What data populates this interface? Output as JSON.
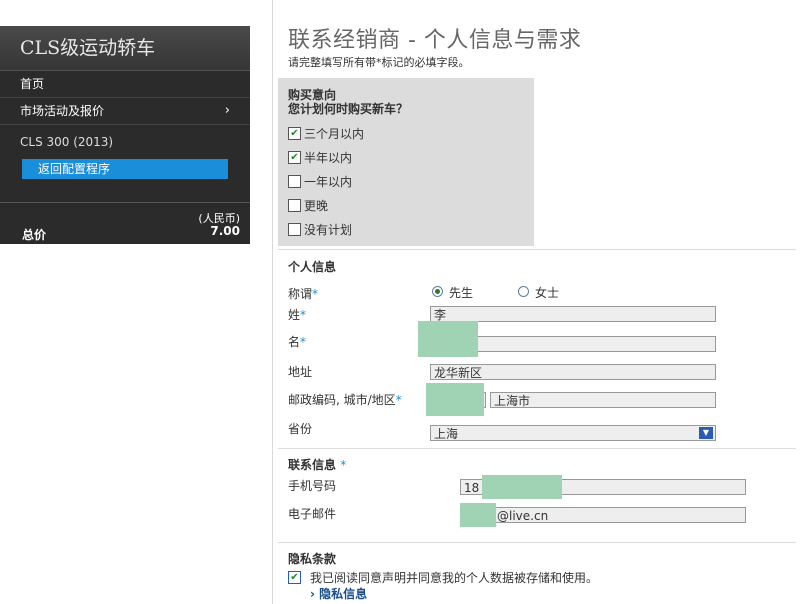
{
  "sidebar": {
    "title": "CLS级运动轿车",
    "items": [
      {
        "label": "首页",
        "chevron": ""
      },
      {
        "label": "市场活动及报价",
        "chevron": "›"
      }
    ],
    "model": "CLS 300 (2013)",
    "back_button": "返回配置程序",
    "total_label": "总价",
    "currency": "(人民币)",
    "price": "7.00"
  },
  "main": {
    "title": "联系经销商 - 个人信息与需求",
    "subtitle": "请完整填写所有带*标记的必填字段。"
  },
  "purchase": {
    "heading1": "购买意向",
    "heading2": "您计划何时购买新车？",
    "options": [
      {
        "label": "三个月以内",
        "checked": true
      },
      {
        "label": "半年以内",
        "checked": true
      },
      {
        "label": "一年以内",
        "checked": false
      },
      {
        "label": "更晚",
        "checked": false
      },
      {
        "label": "没有计划",
        "checked": false
      }
    ]
  },
  "personal": {
    "title": "个人信息",
    "salutation_label": "称谓",
    "salutation_options": [
      "先生",
      "女士"
    ],
    "salutation_selected": "先生",
    "lastname_label": "姓",
    "lastname_value": "李",
    "firstname_label": "名",
    "firstname_value": "",
    "address_label": "地址",
    "address_value": "龙华新区",
    "postcode_label": "邮政编码, 城市/地区",
    "city_value": "上海市",
    "province_label": "省份",
    "province_value": "上海",
    "required_mark": "*"
  },
  "contact": {
    "title": "联系信息",
    "phone_label": "手机号码",
    "phone_value": "18",
    "email_label": "电子邮件",
    "email_value": "@live.cn"
  },
  "privacy": {
    "title": "隐私条款",
    "consent": "我已阅读同意声明并同意我的个人数据被存储和使用。",
    "consent_checked": true,
    "link": "隐私信息",
    "link_icon": "chevron-right-icon"
  },
  "colors": {
    "accent": "#1a8ed8",
    "redaction": "#9fd3b3",
    "sidebar_bg": "#2b2b2b"
  }
}
